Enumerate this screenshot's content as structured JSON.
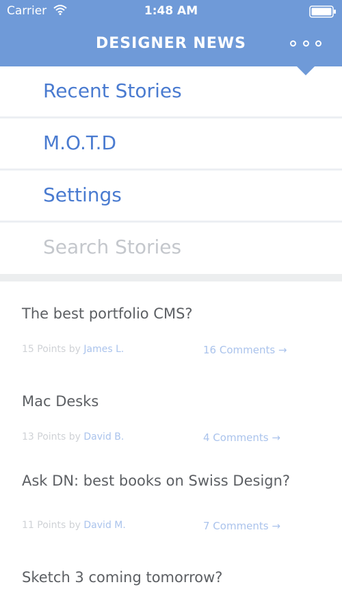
{
  "status_bar": {
    "carrier": "Carrier",
    "time": "1:48 AM"
  },
  "header": {
    "title": "DESIGNER NEWS"
  },
  "menu": {
    "items": [
      {
        "label": "Recent Stories"
      },
      {
        "label": "M.O.T.D"
      },
      {
        "label": "Settings"
      }
    ],
    "search": {
      "placeholder": "Search Stories"
    }
  },
  "stories": [
    {
      "title": "The best portfolio CMS?",
      "points": "15 Points by",
      "author": "James L.",
      "comments": "16 Comments →"
    },
    {
      "title": "Mac Desks",
      "points": "13 Points by",
      "author": "David B.",
      "comments": "4 Comments →"
    },
    {
      "title": "Ask DN: best books on Swiss Design?",
      "points": "11 Points by",
      "author": "David M.",
      "comments": "7 Comments →"
    },
    {
      "title": "Sketch 3 coming tomorrow?"
    }
  ],
  "colors": {
    "header": "#6f9ad8",
    "accent": "#4a7bd0",
    "link_light": "#aac3ec"
  }
}
